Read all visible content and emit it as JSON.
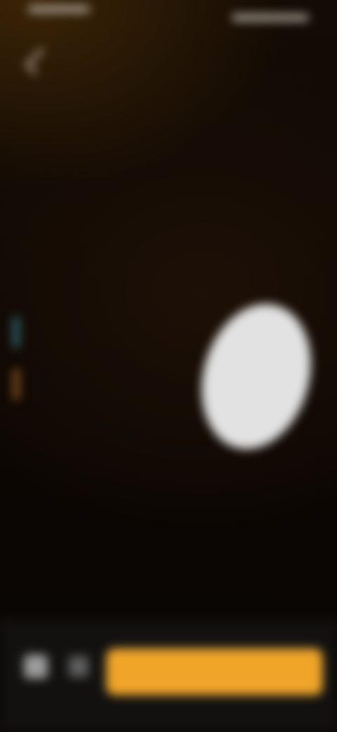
{
  "status": {
    "left": "",
    "right": ""
  },
  "header": {
    "title": "",
    "subtitle": "",
    "dim_text": ""
  },
  "section": {
    "title": ""
  },
  "legend": [
    {
      "label": "",
      "color": "#2f5d6a"
    },
    {
      "label": "",
      "color": "#7d4b1f"
    }
  ],
  "details": {
    "row1_label": "",
    "row1_value": "",
    "row2_label": "",
    "row2_value": "",
    "row3_label": "",
    "row3_value": ""
  },
  "cta": {
    "label": ""
  },
  "colors": {
    "accent": "#f0a529",
    "background": "#0d0703",
    "pill": "#e2e2e2"
  }
}
